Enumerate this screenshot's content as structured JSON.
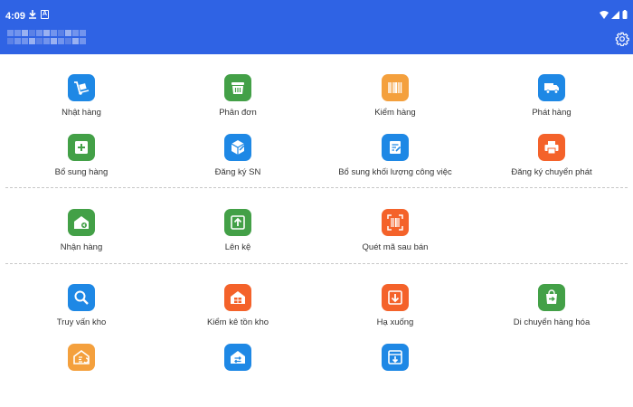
{
  "status_bar": {
    "time": "4:09",
    "a_badge": "A"
  },
  "row1": [
    {
      "label": "Nhật hàng",
      "icon": "hand-truck-icon",
      "color": "#1e88e5"
    },
    {
      "label": "Phân đơn",
      "icon": "basket-icon",
      "color": "#43a047"
    },
    {
      "label": "Kiểm hàng",
      "icon": "barcode-icon",
      "color": "#f4a03d"
    },
    {
      "label": "Phát hàng",
      "icon": "delivery-truck-icon",
      "color": "#1e88e5"
    }
  ],
  "row2": [
    {
      "label": "Bổ sung hàng",
      "icon": "add-box-icon",
      "color": "#43a047"
    },
    {
      "label": "Đăng ký SN",
      "icon": "cube-register-icon",
      "color": "#1e88e5"
    },
    {
      "label": "Bổ sung khối lượng công việc",
      "icon": "edit-document-icon",
      "color": "#1e88e5"
    },
    {
      "label": "Đăng ký chuyển phát",
      "icon": "printer-icon",
      "color": "#f4622a"
    }
  ],
  "row3": [
    {
      "label": "Nhận hàng",
      "icon": "home-receive-icon",
      "color": "#43a047"
    },
    {
      "label": "Lên kệ",
      "icon": "shelf-up-icon",
      "color": "#43a047"
    },
    {
      "label": "Quét mã sau bán",
      "icon": "scan-barcode-icon",
      "color": "#f4622a"
    }
  ],
  "row4": [
    {
      "label": "Truy vấn kho",
      "icon": "magnifier-icon",
      "color": "#1e88e5"
    },
    {
      "label": "Kiểm kê tồn kho",
      "icon": "warehouse-grid-icon",
      "color": "#f4622a"
    },
    {
      "label": "Hạ xuống",
      "icon": "down-box-icon",
      "color": "#f4622a"
    },
    {
      "label": "Di chuyển hàng hóa",
      "icon": "shopping-bag-move-icon",
      "color": "#43a047"
    }
  ],
  "row5": [
    {
      "label": "",
      "icon": "home-return-icon",
      "color": "#f4a03d"
    },
    {
      "label": "",
      "icon": "home-transfer-icon",
      "color": "#1e88e5"
    },
    {
      "label": "",
      "icon": "down-arrow-box-icon",
      "color": "#1e88e5"
    }
  ]
}
